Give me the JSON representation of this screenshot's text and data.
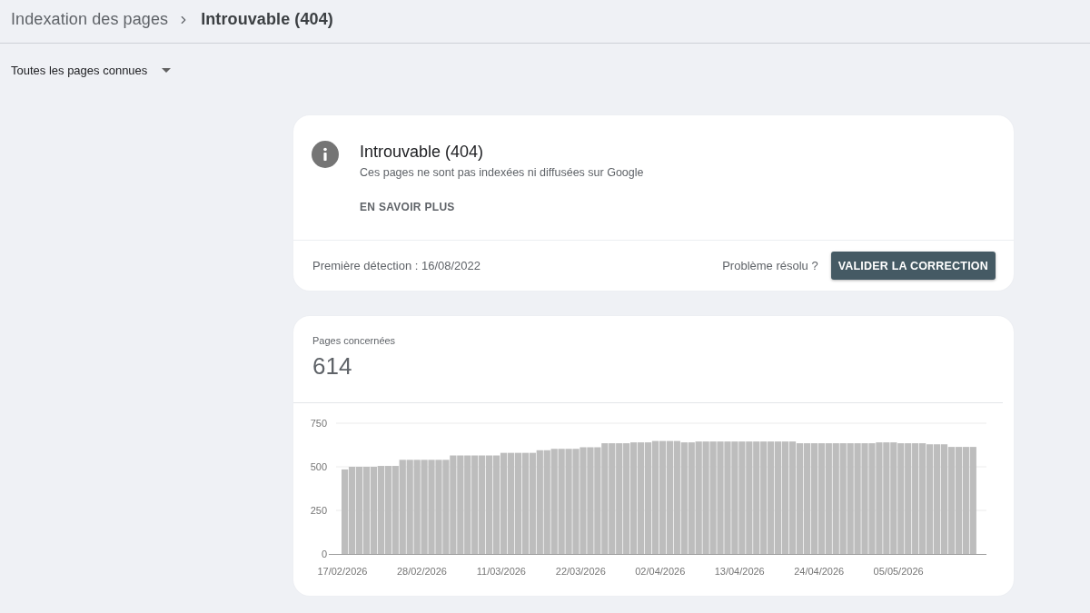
{
  "breadcrumb": {
    "items": [
      {
        "label": "Indexation des pages",
        "current": false
      },
      {
        "label": "Introuvable (404)",
        "current": true
      }
    ]
  },
  "filter": {
    "value": "Toutes les pages connues"
  },
  "issue_card": {
    "title": "Introuvable (404)",
    "description": "Ces pages ne sont pas indexées ni diffusées sur Google",
    "link": "EN SAVOIR PLUS",
    "first_detected": "Première détection : 16/08/2022",
    "question": "Problème résolu ?",
    "button": "VALIDER LA CORRECTION"
  },
  "affected_card": {
    "label": "Pages concernées",
    "count": "614",
    "chart_data": {
      "type": "bar",
      "categories": [
        "17/02/2026",
        null,
        null,
        null,
        null,
        null,
        null,
        null,
        null,
        null,
        null,
        "28/02/2026",
        null,
        null,
        null,
        null,
        null,
        null,
        null,
        null,
        null,
        null,
        "11/03/2026",
        null,
        null,
        null,
        null,
        null,
        null,
        null,
        null,
        null,
        null,
        "22/03/2026",
        null,
        null,
        null,
        null,
        null,
        null,
        null,
        null,
        null,
        null,
        "02/04/2026",
        null,
        null,
        null,
        null,
        null,
        null,
        null,
        null,
        null,
        null,
        "13/04/2026",
        null,
        null,
        null,
        null,
        null,
        null,
        null,
        null,
        null,
        null,
        "24/04/2026",
        null,
        null,
        null,
        null,
        null,
        null,
        null,
        null,
        null,
        null,
        "05/05/2026",
        null,
        null,
        null,
        null,
        null,
        null,
        null,
        null,
        null,
        null
      ],
      "values": [
        485,
        500,
        500,
        500,
        500,
        505,
        505,
        505,
        540,
        540,
        540,
        540,
        540,
        540,
        540,
        565,
        565,
        565,
        565,
        565,
        565,
        565,
        580,
        580,
        580,
        580,
        580,
        595,
        595,
        603,
        603,
        603,
        603,
        612,
        612,
        612,
        635,
        635,
        635,
        635,
        640,
        640,
        640,
        648,
        648,
        648,
        648,
        640,
        640,
        645,
        645,
        645,
        645,
        645,
        645,
        645,
        645,
        645,
        645,
        645,
        645,
        645,
        645,
        635,
        635,
        635,
        635,
        635,
        635,
        635,
        635,
        635,
        635,
        635,
        640,
        640,
        640,
        635,
        635,
        635,
        635,
        629,
        629,
        629,
        614,
        614,
        614,
        614
      ],
      "ylim": [
        0,
        750
      ],
      "yticks": [
        0,
        250,
        500,
        750
      ]
    }
  }
}
